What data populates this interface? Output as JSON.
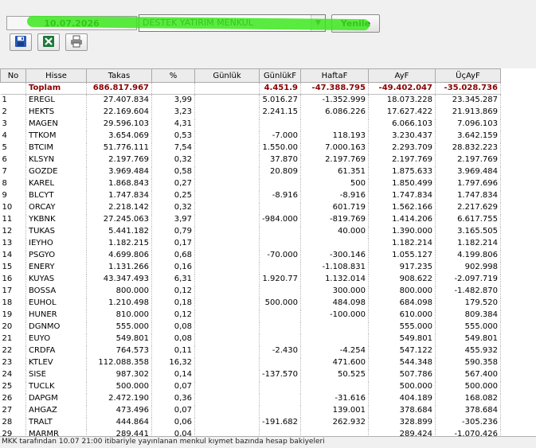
{
  "toolbar": {
    "date": "10.07.2026",
    "broker": "DESTEK YATIRIM MENKUL",
    "refresh_label": "Yenile",
    "highlight_color": "#3ce81d"
  },
  "icons": [
    "save-icon",
    "excel-icon",
    "print-icon"
  ],
  "table": {
    "headers": [
      "No",
      "Hisse",
      "Takas",
      "%",
      "Günlük",
      "GünlükF",
      "HaftaF",
      "AyF",
      "ÜçAyF"
    ],
    "total": [
      "",
      "Toplam",
      "686.817.967",
      "",
      "",
      "4.451.9",
      "-47.388.795",
      "-49.402.047",
      "-35.028.736"
    ],
    "rows": [
      [
        "1",
        "EREGL",
        "27.407.834",
        "3,99",
        "",
        "5.016.27",
        "-1.352.999",
        "18.073.228",
        "23.345.287"
      ],
      [
        "2",
        "HEKTS",
        "22.169.604",
        "3,23",
        "",
        "2.241.15",
        "6.086.226",
        "17.627.422",
        "21.913.869"
      ],
      [
        "3",
        "MAGEN",
        "29.596.103",
        "4,31",
        "",
        "",
        "",
        "6.066.103",
        "7.096.103"
      ],
      [
        "4",
        "TTKOM",
        "3.654.069",
        "0,53",
        "",
        "-7.000",
        "118.193",
        "3.230.437",
        "3.642.159"
      ],
      [
        "5",
        "BTCIM",
        "51.776.111",
        "7,54",
        "",
        "1.550.00",
        "7.000.163",
        "2.293.709",
        "28.832.223"
      ],
      [
        "6",
        "KLSYN",
        "2.197.769",
        "0,32",
        "",
        "37.870",
        "2.197.769",
        "2.197.769",
        "2.197.769"
      ],
      [
        "7",
        "GOZDE",
        "3.969.484",
        "0,58",
        "",
        "20.809",
        "61.351",
        "1.875.633",
        "3.969.484"
      ],
      [
        "8",
        "KAREL",
        "1.868.843",
        "0,27",
        "",
        "",
        "500",
        "1.850.499",
        "1.797.696"
      ],
      [
        "9",
        "BLCYT",
        "1.747.834",
        "0,25",
        "",
        "-8.916",
        "-8.916",
        "1.747.834",
        "1.747.834"
      ],
      [
        "10",
        "ORCAY",
        "2.218.142",
        "0,32",
        "",
        "",
        "601.719",
        "1.562.166",
        "2.217.629"
      ],
      [
        "11",
        "YKBNK",
        "27.245.063",
        "3,97",
        "",
        "-984.000",
        "-819.769",
        "1.414.206",
        "6.617.755"
      ],
      [
        "12",
        "TUKAS",
        "5.441.182",
        "0,79",
        "",
        "",
        "40.000",
        "1.390.000",
        "3.165.505"
      ],
      [
        "13",
        "IEYHO",
        "1.182.215",
        "0,17",
        "",
        "",
        "",
        "1.182.214",
        "1.182.214"
      ],
      [
        "14",
        "PSGYO",
        "4.699.806",
        "0,68",
        "",
        "-70.000",
        "-300.146",
        "1.055.127",
        "4.199.806"
      ],
      [
        "15",
        "ENERY",
        "1.131.266",
        "0,16",
        "",
        "",
        "-1.108.831",
        "917.235",
        "902.998"
      ],
      [
        "16",
        "KUYAS",
        "43.347.493",
        "6,31",
        "",
        "1.920.77",
        "1.132.014",
        "908.622",
        "-2.097.719"
      ],
      [
        "17",
        "BOSSA",
        "800.000",
        "0,12",
        "",
        "",
        "300.000",
        "800.000",
        "-1.482.870"
      ],
      [
        "18",
        "EUHOL",
        "1.210.498",
        "0,18",
        "",
        "500.000",
        "484.098",
        "684.098",
        "179.520"
      ],
      [
        "19",
        "HUNER",
        "810.000",
        "0,12",
        "",
        "",
        "-100.000",
        "610.000",
        "809.384"
      ],
      [
        "20",
        "DGNMO",
        "555.000",
        "0,08",
        "",
        "",
        "",
        "555.000",
        "555.000"
      ],
      [
        "21",
        "EUYO",
        "549.801",
        "0,08",
        "",
        "",
        "",
        "549.801",
        "549.801"
      ],
      [
        "22",
        "CRDFA",
        "764.573",
        "0,11",
        "",
        "-2.430",
        "-4.254",
        "547.122",
        "455.932"
      ],
      [
        "23",
        "KTLEV",
        "112.088.358",
        "16,32",
        "",
        "",
        "471.600",
        "544.348",
        "590.358"
      ],
      [
        "24",
        "SISE",
        "987.302",
        "0,14",
        "",
        "-137.570",
        "50.525",
        "507.786",
        "567.400"
      ],
      [
        "25",
        "TUCLK",
        "500.000",
        "0,07",
        "",
        "",
        "",
        "500.000",
        "500.000"
      ],
      [
        "26",
        "DAPGM",
        "2.472.190",
        "0,36",
        "",
        "",
        "-31.616",
        "404.189",
        "168.082"
      ],
      [
        "27",
        "AHGAZ",
        "473.496",
        "0,07",
        "",
        "",
        "139.001",
        "378.684",
        "378.684"
      ],
      [
        "28",
        "TRALT",
        "444.864",
        "0,06",
        "",
        "-191.682",
        "262.932",
        "328.899",
        "-305.236"
      ],
      [
        "29",
        "MARMR",
        "289.441",
        "0,04",
        "",
        "",
        "",
        "289.424",
        "-1.070.426"
      ]
    ]
  },
  "status_text": "MKK tarafından 10.07 21:00 itibariyle yayınlanan menkul kıymet bazında hesap bakiyeleri"
}
